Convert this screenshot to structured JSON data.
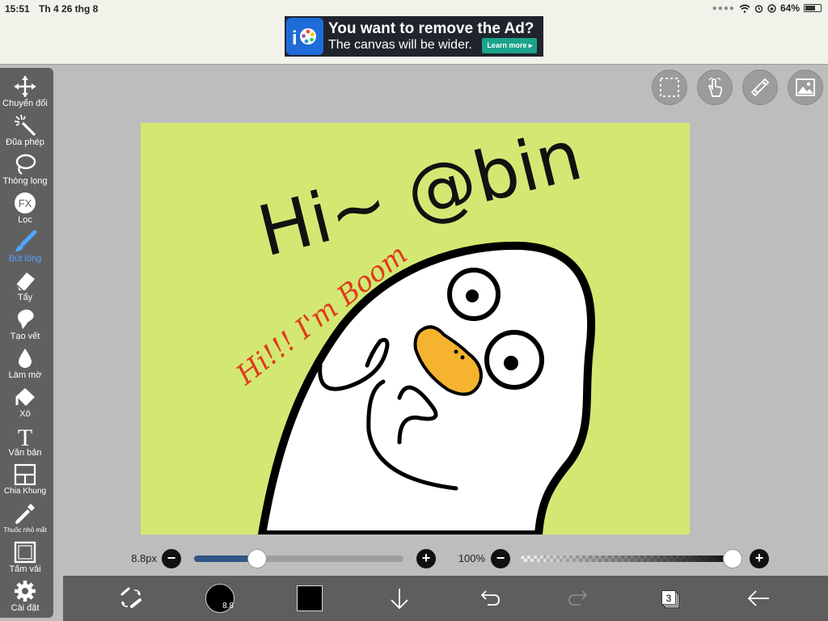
{
  "status_bar": {
    "time": "15:51",
    "date": "Th 4 26 thg 8",
    "battery_percent": "64%",
    "battery_level": 0.64
  },
  "ad": {
    "headline": "You want to remove the Ad?",
    "subtext": "The canvas will be wider.",
    "cta": "Learn more ▸"
  },
  "toolbar": {
    "tools": [
      {
        "label": "Chuyển đổi",
        "icon": "move-arrows-icon"
      },
      {
        "label": "Đũa phép",
        "icon": "magic-wand-icon"
      },
      {
        "label": "Thòng lọng",
        "icon": "lasso-icon"
      },
      {
        "label": "Lọc",
        "icon": "fx-filter-icon"
      },
      {
        "label": "Bút lông",
        "icon": "brush-icon",
        "active": true
      },
      {
        "label": "Tẩy",
        "icon": "eraser-icon"
      },
      {
        "label": "Tạo vết",
        "icon": "smudge-icon"
      },
      {
        "label": "Làm mờ",
        "icon": "blur-drop-icon"
      },
      {
        "label": "Xô",
        "icon": "bucket-icon"
      },
      {
        "label": "Văn bản",
        "icon": "text-icon"
      },
      {
        "label": "Chia Khung",
        "icon": "frame-divider-icon"
      },
      {
        "label": "Thuốc nhỏ mắt",
        "icon": "eyedropper-icon"
      },
      {
        "label": "Tấm vải",
        "icon": "canvas-icon"
      },
      {
        "label": "Cài đặt",
        "icon": "gear-icon"
      }
    ]
  },
  "top_buttons": [
    "selection-icon",
    "hand-gesture-icon",
    "ruler-icon",
    "image-icon"
  ],
  "canvas": {
    "background": "#d3e873",
    "drawing_text_1": "Hi~ @bin",
    "drawing_text_2": "Hi!!! I'm Boom"
  },
  "brush_size": {
    "label": "8.8px",
    "level": 0.3
  },
  "opacity": {
    "label": "100%",
    "level": 1.0
  },
  "bottom_bar": {
    "brush_size_value": "8.8",
    "color": "#000000",
    "layer_count": "3"
  },
  "colors": {
    "accent_active": "#4fa6ff",
    "toolbar_bg": "#606060",
    "slider_fill": "#2f5686"
  }
}
